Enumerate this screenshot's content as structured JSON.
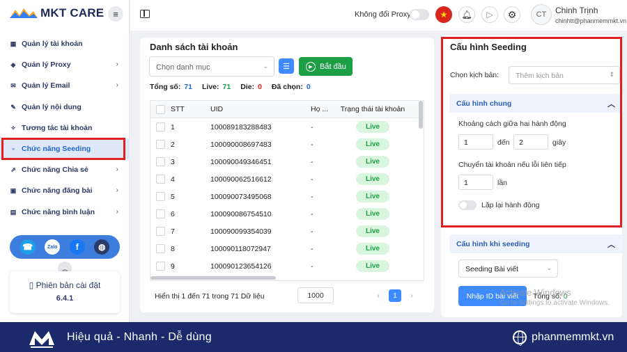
{
  "app": {
    "brand": "MKT CARE"
  },
  "sidebar": {
    "items": [
      {
        "label": "Quản lý tài khoản",
        "icon": "grid-icon",
        "chevron": false
      },
      {
        "label": "Quản lý Proxy",
        "icon": "layers-icon",
        "chevron": true
      },
      {
        "label": "Quản lý Email",
        "icon": "mail-icon",
        "chevron": true
      },
      {
        "label": "Quản lý nội dung",
        "icon": "content-icon",
        "chevron": false
      },
      {
        "label": "Tương tác tài khoản",
        "icon": "interact-icon",
        "chevron": false
      },
      {
        "label": "Chức năng Seeding",
        "icon": "seeding-icon",
        "chevron": false,
        "active": true
      },
      {
        "label": "Chức năng Chia sẻ",
        "icon": "share-icon",
        "chevron": true
      },
      {
        "label": "Chức năng đăng bài",
        "icon": "post-icon",
        "chevron": true
      },
      {
        "label": "Chức năng bình luận",
        "icon": "comment-icon",
        "chevron": true
      }
    ],
    "social": {
      "zalo": "Zalo",
      "facebook": "f"
    },
    "version": {
      "label": "Phiên bản cài đặt",
      "value": "6.4.1"
    }
  },
  "topbar": {
    "proxy_label": "Không đổi Proxy",
    "avatar_initials": "CT",
    "user_name": "Chinh Trịnh",
    "user_email": "chinhtt@phanmemmkt.vn"
  },
  "accounts": {
    "title": "Danh sách tài khoản",
    "category_placeholder": "Chọn danh mục",
    "start_label": "Bắt đầu",
    "stats": {
      "total_label": "Tổng số:",
      "total": "71",
      "live_label": "Live:",
      "live": "71",
      "die_label": "Die:",
      "die": "0",
      "selected_label": "Đã chọn:",
      "selected": "0"
    },
    "columns": [
      "STT",
      "UID",
      "Họ ...",
      "Trạng thái tài khoản"
    ],
    "rows": [
      {
        "stt": "1",
        "uid": "100089183288483",
        "name": "-",
        "status": "Live"
      },
      {
        "stt": "2",
        "uid": "100090008697483",
        "name": "-",
        "status": "Live"
      },
      {
        "stt": "3",
        "uid": "100090049346451",
        "name": "-",
        "status": "Live"
      },
      {
        "stt": "4",
        "uid": "100090062516612",
        "name": "-",
        "status": "Live"
      },
      {
        "stt": "5",
        "uid": "100090073495068",
        "name": "-",
        "status": "Live"
      },
      {
        "stt": "6",
        "uid": "100090086754510",
        "name": "-",
        "status": "Live"
      },
      {
        "stt": "7",
        "uid": "100090099354039",
        "name": "-",
        "status": "Live"
      },
      {
        "stt": "8",
        "uid": "100090118072947",
        "name": "-",
        "status": "Live"
      },
      {
        "stt": "9",
        "uid": "100090123654126",
        "name": "-",
        "status": "Live"
      }
    ],
    "footer_info": "Hiển thị 1 đến 71 trong 71 Dữ liệu",
    "page_size": "1000",
    "pagination": {
      "prev": "‹",
      "current": "1",
      "next": "›"
    },
    "colors": {
      "live_bg": "#d8f5de",
      "live_text": "#1c9e45",
      "total": "#1e66d0",
      "die": "#e02020"
    }
  },
  "config": {
    "title": "Cấu hình Seeding",
    "scenario_label": "Chọn kịch bản:",
    "scenario_placeholder": "Thêm kịch bản",
    "general": {
      "title": "Cấu hình chung",
      "interval_label": "Khoảng cách giữa hai hành động",
      "from": "1",
      "to_label": "đến",
      "to": "2",
      "unit": "giây",
      "switch_label": "Chuyển tài khoản nếu lỗi liên tiếp",
      "switch_value": "1",
      "switch_unit": "lần",
      "repeat_label": "Lặp lại hành động"
    },
    "seeding": {
      "title": "Cấu hình khi seeding",
      "type": "Seeding Bài viết",
      "import_label": "Nhập ID bài viết",
      "total_label": "Tổng số:",
      "total": "0"
    }
  },
  "watermark": {
    "line1": "Activate Windows",
    "line2": "Go to Settings to activate Windows."
  },
  "banner": {
    "slogan": "Hiệu quả - Nhanh - Dễ dùng",
    "website": "phanmemmkt.vn",
    "bg": "#1b2a6b"
  }
}
